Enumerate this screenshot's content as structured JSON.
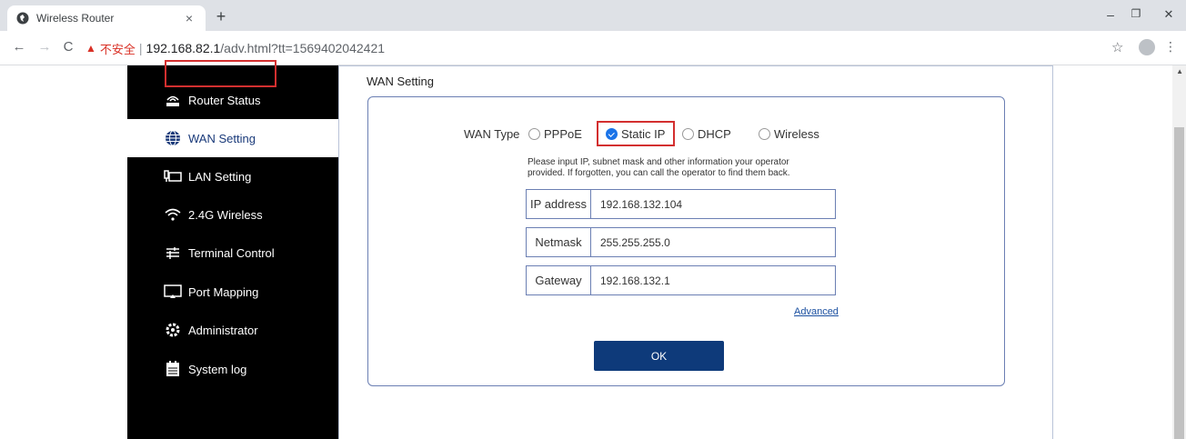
{
  "browser": {
    "tab_title": "Wireless Router",
    "tab_close": "×",
    "new_tab": "+",
    "not_secure": "不安全",
    "url_host": "192.168.82.1",
    "url_path": "/adv.html?tt=1569402042421",
    "window_controls": {
      "minimize": "–",
      "restore": "❐",
      "close": "✕"
    }
  },
  "sidebar": {
    "items": [
      {
        "label": "Router Status",
        "icon": "router-icon"
      },
      {
        "label": "WAN Setting",
        "icon": "globe-icon",
        "active": true
      },
      {
        "label": "LAN Setting",
        "icon": "monitor-icon"
      },
      {
        "label": "2.4G Wireless",
        "icon": "wifi-icon"
      },
      {
        "label": "Terminal Control",
        "icon": "sliders-icon"
      },
      {
        "label": "Port Mapping",
        "icon": "cast-icon"
      },
      {
        "label": "Administrator",
        "icon": "gear-icon"
      },
      {
        "label": "System log",
        "icon": "log-icon"
      }
    ]
  },
  "main": {
    "section_title": "WAN Setting",
    "wan_type_label": "WAN Type",
    "wan_types": [
      {
        "label": "PPPoE",
        "checked": false
      },
      {
        "label": "Static IP",
        "checked": true
      },
      {
        "label": "DHCP",
        "checked": false
      },
      {
        "label": "Wireless",
        "checked": false
      }
    ],
    "hint_line1": "Please input IP, subnet mask and other information your operator",
    "hint_line2": "provided. If forgotten, you can call the operator to find them back.",
    "fields": {
      "ip": {
        "label": "IP address",
        "value": "192.168.132.104"
      },
      "netmask": {
        "label": "Netmask",
        "value": "255.255.255.0"
      },
      "gateway": {
        "label": "Gateway",
        "value": "192.168.132.1"
      }
    },
    "advanced_link": "Advanced",
    "ok_label": "OK"
  },
  "colors": {
    "sidebar_bg": "#000000",
    "accent": "#0e3a7a",
    "highlight_border": "#d32f2f"
  }
}
